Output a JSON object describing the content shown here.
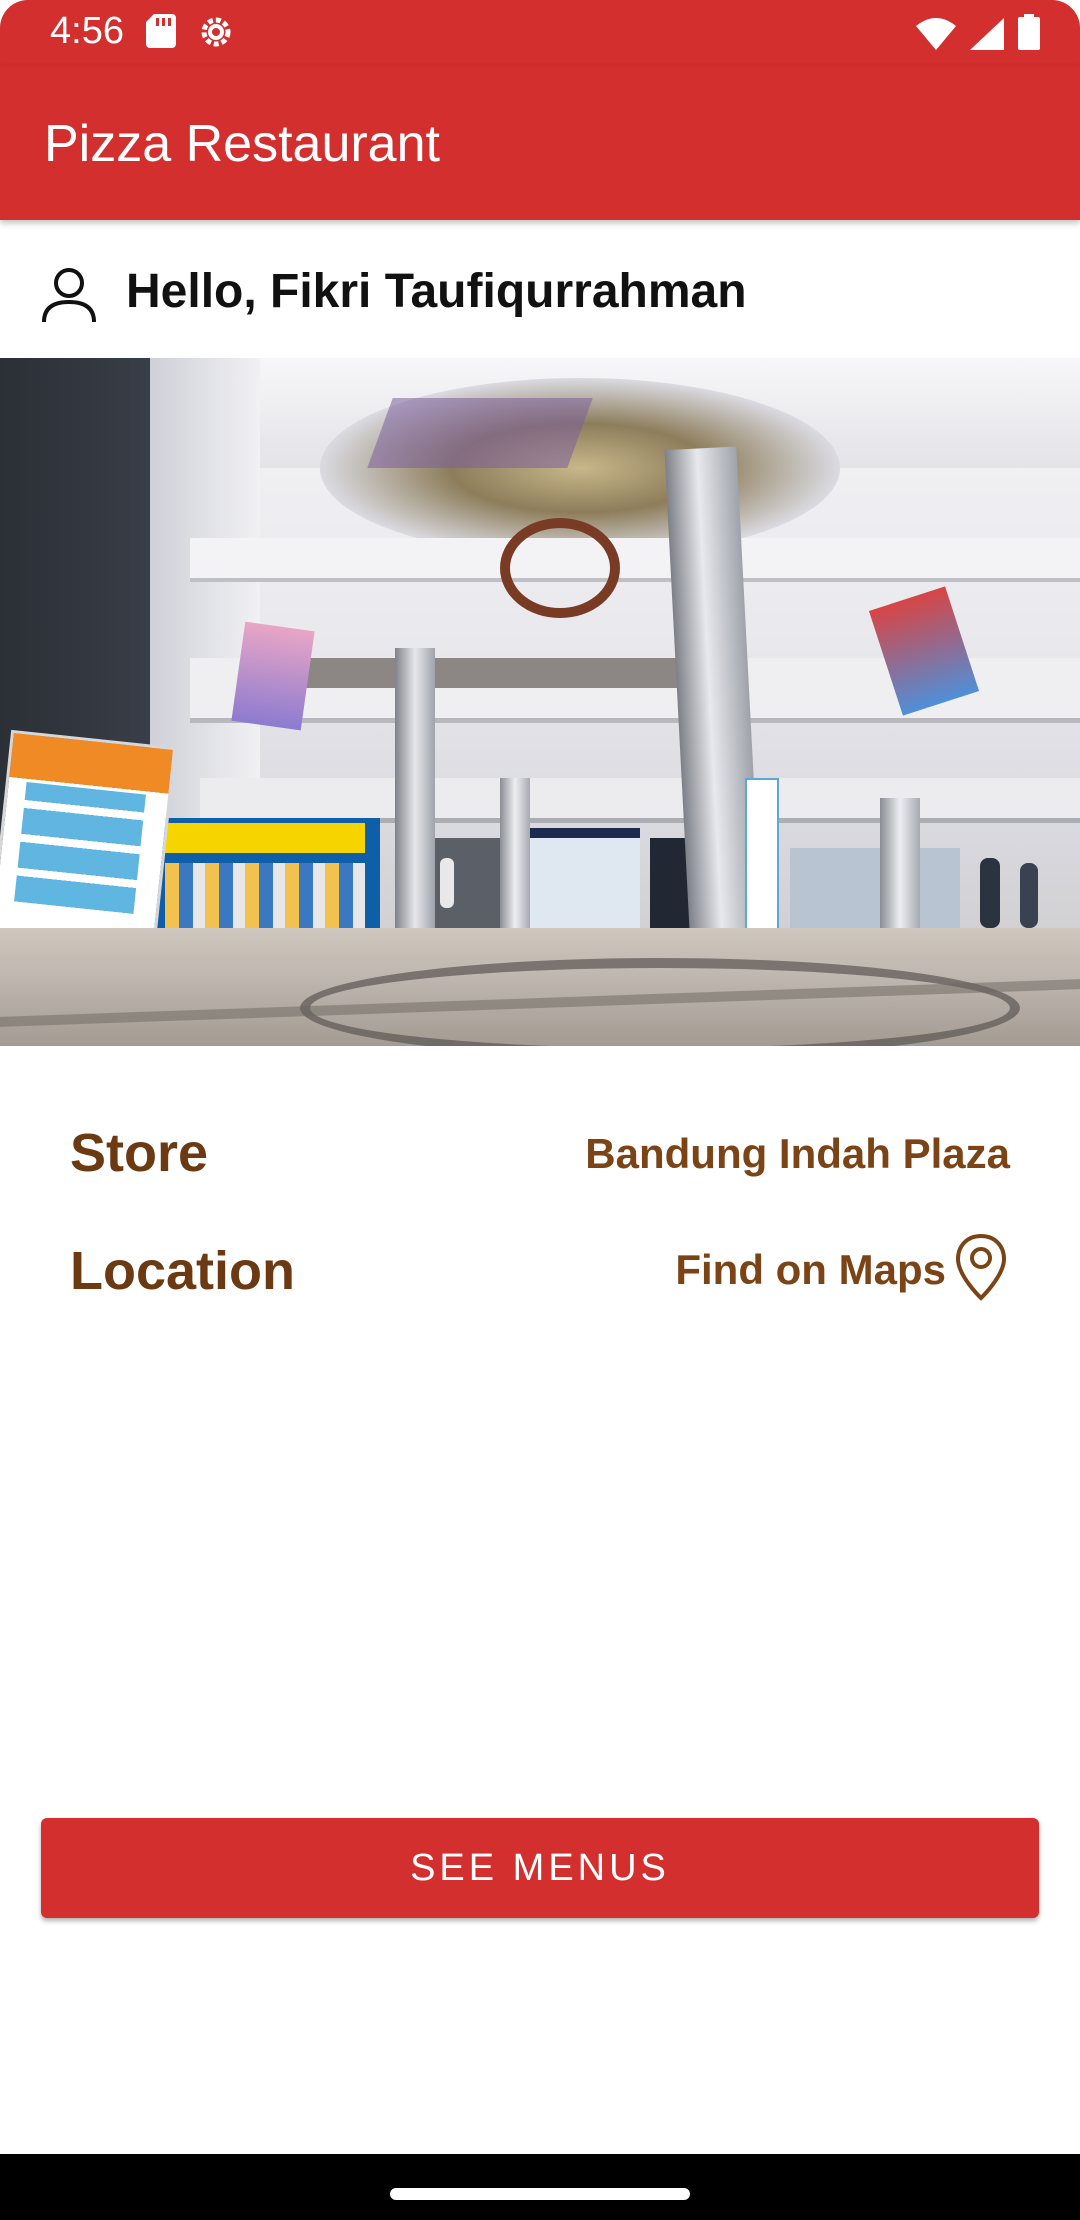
{
  "status_bar": {
    "time": "4:56",
    "icons": [
      "sd-card-icon",
      "settings-gear-icon",
      "wifi-icon",
      "signal-icon",
      "battery-icon"
    ]
  },
  "app_bar": {
    "title": "Pizza Restaurant"
  },
  "greeting": {
    "text": "Hello, Fikri Taufiqurrahman",
    "icon": "person-icon"
  },
  "store_photo": {
    "description_icon": "mall-photo"
  },
  "details": {
    "store_label": "Store",
    "store_value": "Bandung Indah Plaza",
    "location_label": "Location",
    "location_link": "Find on Maps",
    "location_icon": "map-pin-icon"
  },
  "actions": {
    "see_menus_label": "SEE MENUS"
  },
  "colors": {
    "primary": "#d32f2f",
    "label_brown": "#6b3a12",
    "value_brown": "#7a4416"
  }
}
